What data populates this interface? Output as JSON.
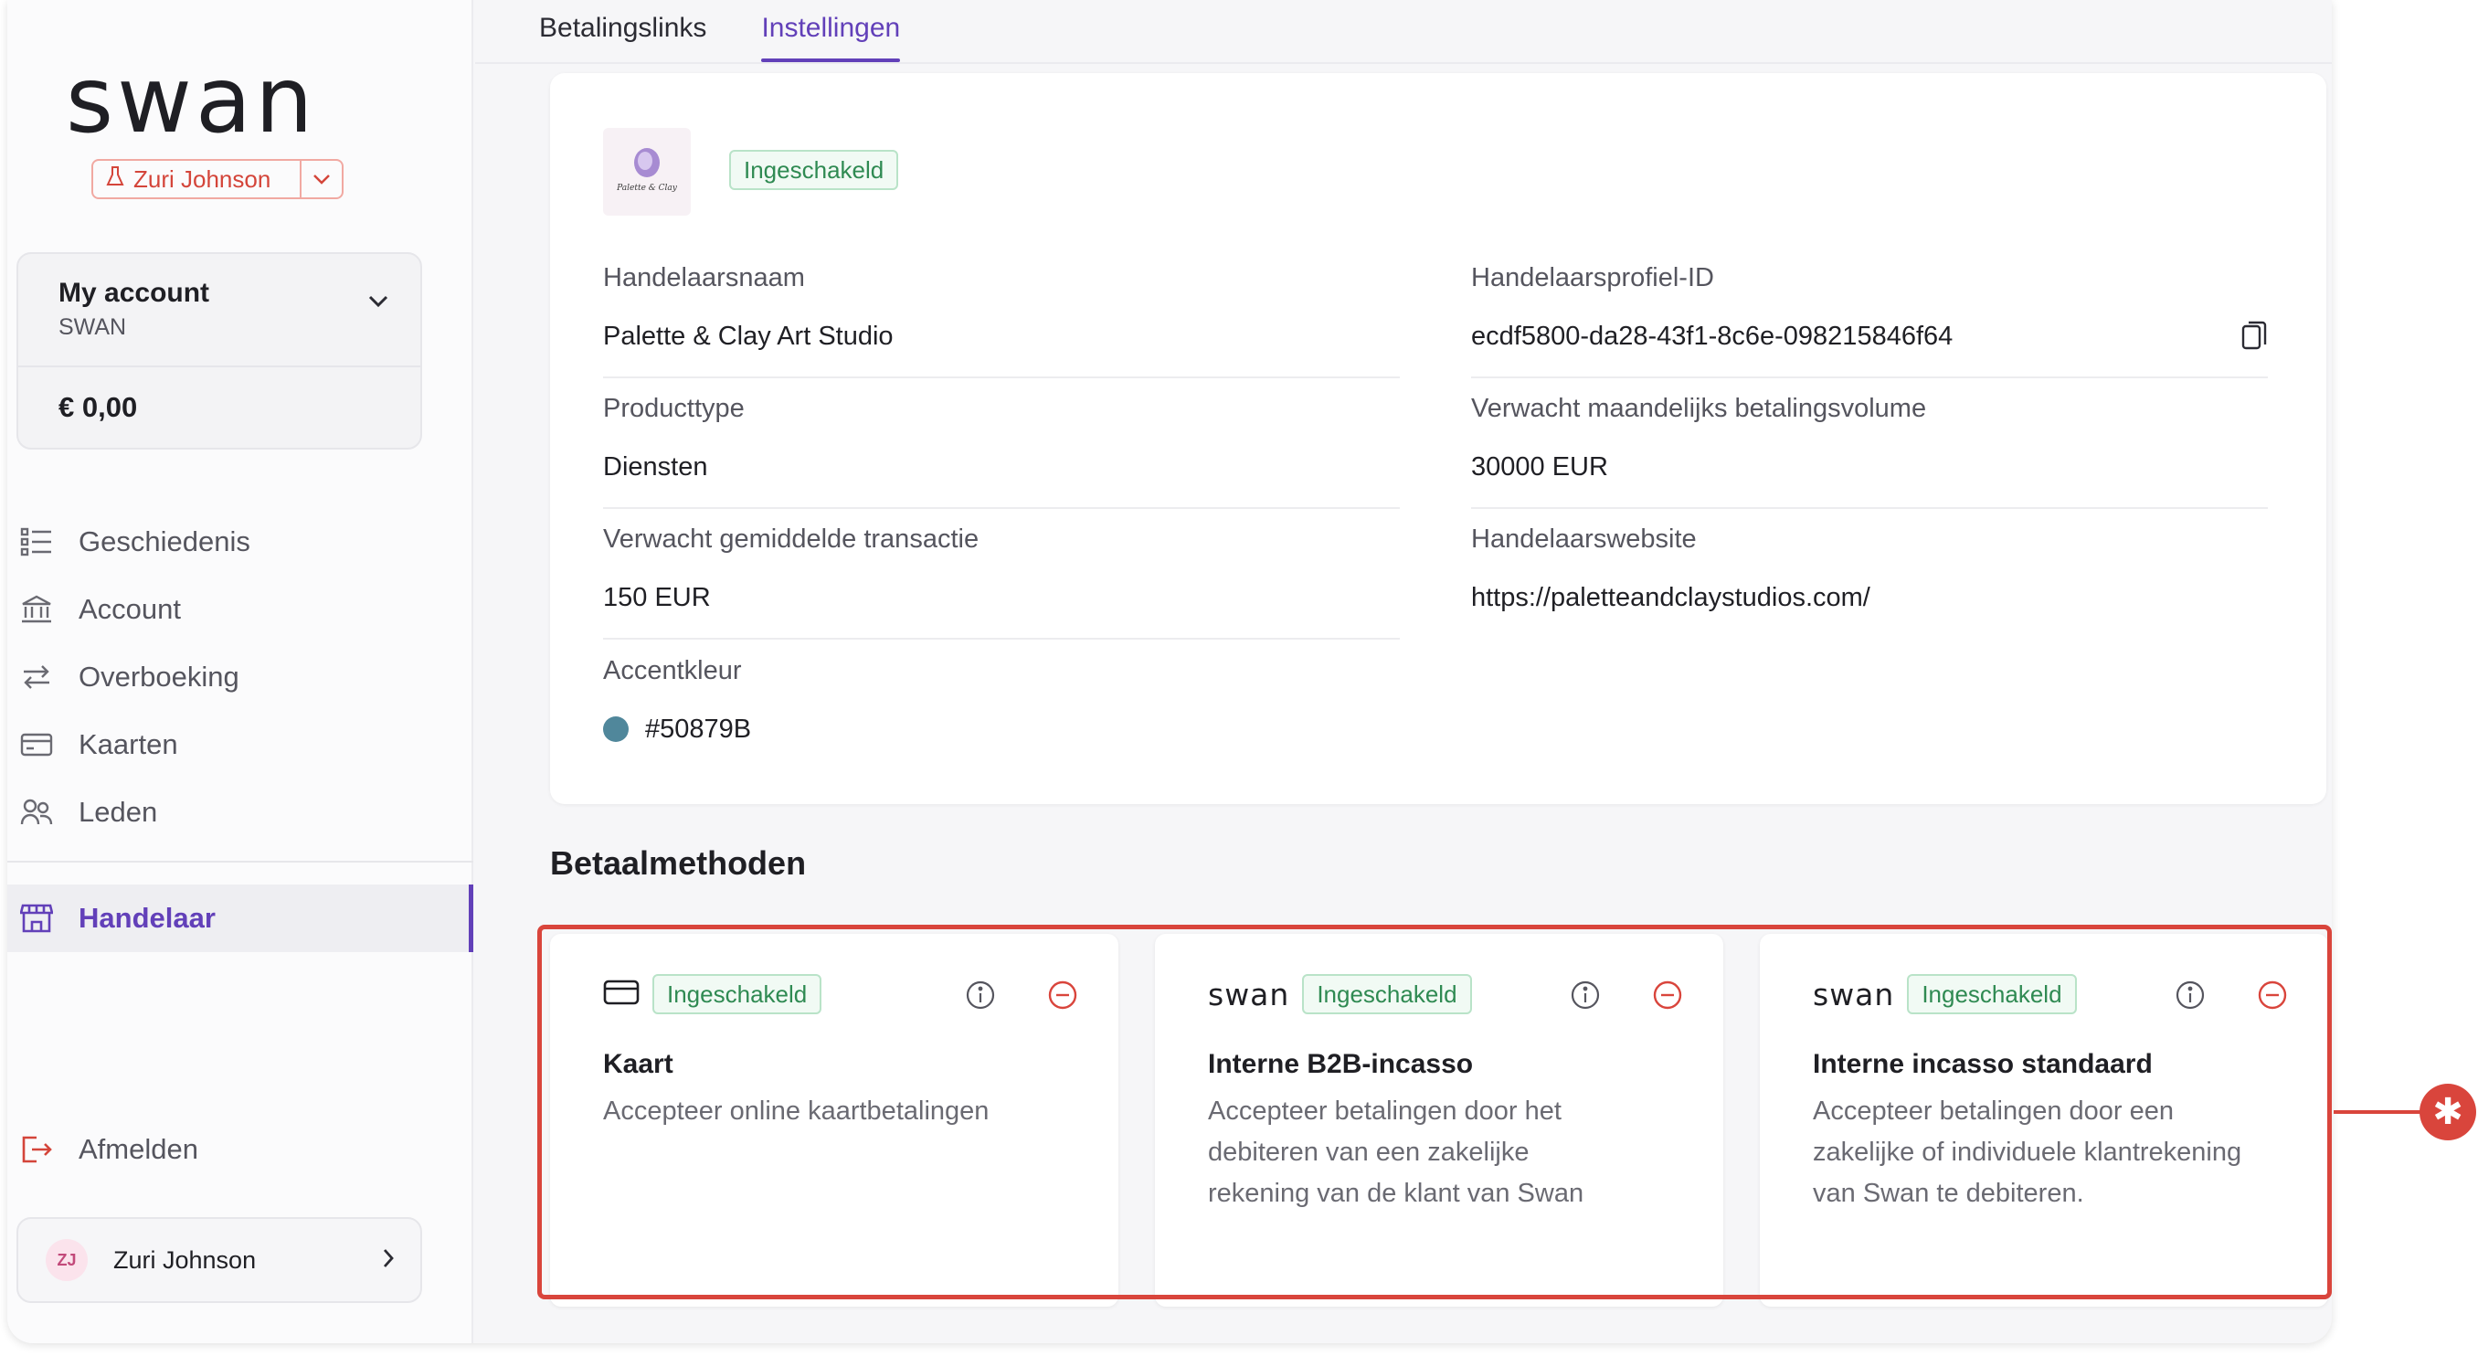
{
  "brand": {
    "logo_text": "swan",
    "accent": "#6240b9",
    "danger": "#d9453c",
    "success": "#2f8a52"
  },
  "project": {
    "name": "Zuri Johnson",
    "icon": "flask-icon"
  },
  "account_switcher": {
    "title": "My account",
    "subtitle": "SWAN",
    "balance": "€ 0,00"
  },
  "nav": {
    "items": [
      {
        "label": "Geschiedenis",
        "icon": "list-icon"
      },
      {
        "label": "Account",
        "icon": "bank-icon"
      },
      {
        "label": "Overboeking",
        "icon": "transfer-icon"
      },
      {
        "label": "Kaarten",
        "icon": "card-icon"
      },
      {
        "label": "Leden",
        "icon": "members-icon"
      }
    ],
    "active": {
      "label": "Handelaar",
      "icon": "store-icon"
    },
    "logout": "Afmelden"
  },
  "user": {
    "initials": "ZJ",
    "name": "Zuri Johnson"
  },
  "tabs": [
    {
      "label": "Betalingslinks",
      "active": false
    },
    {
      "label": "Instellingen",
      "active": true
    }
  ],
  "profile": {
    "status": "Ingeschakeld",
    "logo_text": "Palette & Clay",
    "fields": {
      "merchant_name": {
        "label": "Handelaarsnaam",
        "value": "Palette & Clay Art Studio"
      },
      "profile_id": {
        "label": "Handelaarsprofiel-ID",
        "value": "ecdf5800-da28-43f1-8c6e-098215846f64"
      },
      "product_type": {
        "label": "Producttype",
        "value": "Diensten"
      },
      "monthly_volume": {
        "label": "Verwacht maandelijks betalingsvolume",
        "value": "30000 EUR"
      },
      "avg_transaction": {
        "label": "Verwacht gemiddelde transactie",
        "value": "150 EUR"
      },
      "website": {
        "label": "Handelaarswebsite",
        "value": "https://paletteandclaystudios.com/"
      },
      "accent_color": {
        "label": "Accentkleur",
        "value": "#50879B"
      }
    }
  },
  "payment_methods": {
    "title": "Betaalmethoden",
    "items": [
      {
        "logo": "card-icon",
        "status": "Ingeschakeld",
        "name": "Kaart",
        "description": "Accepteer online kaartbetalingen"
      },
      {
        "logo": "swan",
        "status": "Ingeschakeld",
        "name": "Interne B2B-incasso",
        "description": "Accepteer betalingen door het debiteren van een zakelijke rekening van de klant van Swan"
      },
      {
        "logo": "swan",
        "status": "Ingeschakeld",
        "name": "Interne incasso standaard",
        "description": "Accepteer betalingen door een zakelijke of individuele klantrekening van Swan te debiteren."
      }
    ]
  },
  "callout": {
    "symbol": "✱"
  }
}
